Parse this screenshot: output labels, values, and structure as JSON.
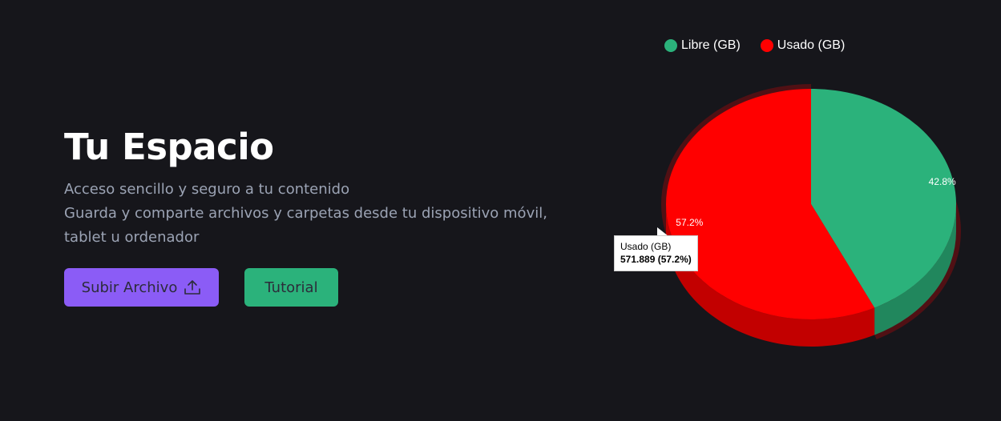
{
  "hero": {
    "title": "Tu Espacio",
    "description_lines": [
      "Acceso sencillo y seguro a tu contenido",
      "Guarda y comparte archivos y carpetas desde tu dispositivo móvil,",
      "tablet u ordenador"
    ],
    "upload_button": "Subir Archivo",
    "tutorial_button": "Tutorial"
  },
  "colors": {
    "background": "#16161b",
    "upload_button": "#8b5cf6",
    "tutorial_button": "#2bb27b"
  },
  "chart_data": {
    "type": "pie",
    "three_d": true,
    "legend_position": "top",
    "series": [
      {
        "name": "Libre (GB)",
        "percent": 42.8,
        "color": "#2bb27b",
        "data_label": "42.8%"
      },
      {
        "name": "Usado (GB)",
        "value": 571.889,
        "percent": 57.2,
        "color": "#ff0000",
        "data_label": "57.2%",
        "highlighted": true
      }
    ],
    "tooltip": {
      "series": "Usado (GB)",
      "title": "Usado (GB)",
      "value_text": "571.889 (57.2%)"
    }
  }
}
